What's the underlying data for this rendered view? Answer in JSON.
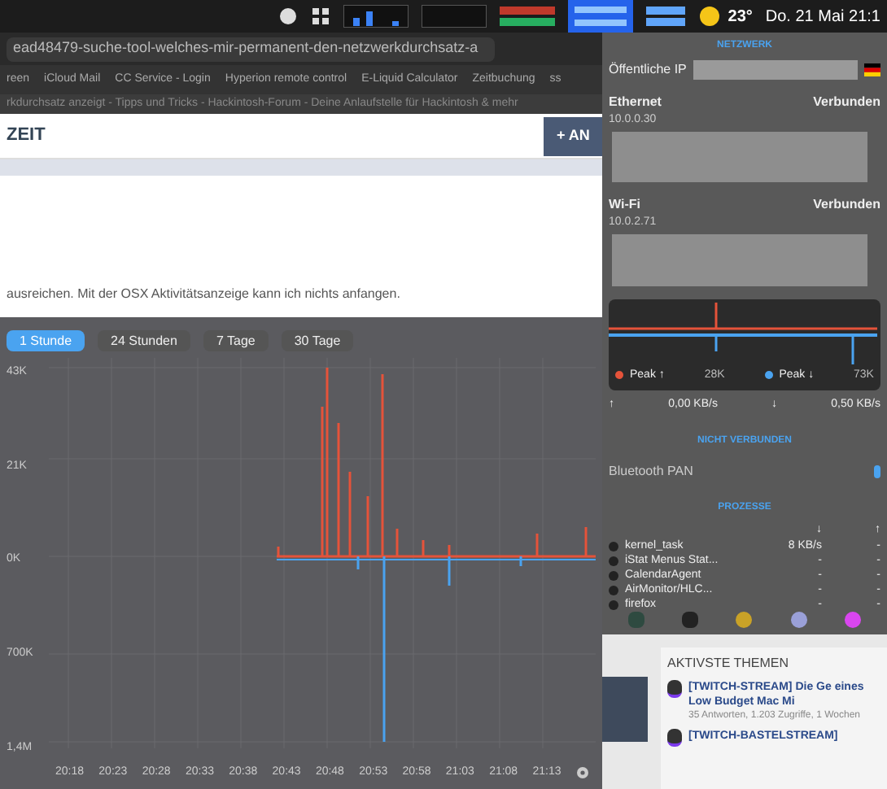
{
  "menu_bar": {
    "temperature": "23°",
    "clock": "Do. 21 Mai 21:1"
  },
  "browser": {
    "url": "ead48479-suche-tool-welches-mir-permanent-den-netzwerkdurchsatz-a",
    "bookmarks": [
      "reen",
      "iCloud Mail",
      "CC Service - Login",
      "Hyperion remote control",
      "E-Liquid Calculator",
      "Zeitbuchung",
      "ss"
    ],
    "tab_title": "rkdurchsatz anzeigt - Tipps und Tricks - Hackintosh-Forum - Deine Anlaufstelle für Hackintosh & mehr",
    "heading": "ZEIT",
    "button": "+ AN",
    "post_text": "ausreichen. Mit der OSX Aktivitätsanzeige kann ich nichts anfangen."
  },
  "chart_panel": {
    "tabs": [
      {
        "label": "1 Stunde",
        "selected": true
      },
      {
        "label": "24 Stunden",
        "selected": false
      },
      {
        "label": "7 Tage",
        "selected": false
      },
      {
        "label": "30 Tage",
        "selected": false
      }
    ],
    "y_labels": [
      "43K",
      "21K",
      "0K",
      "700K",
      "1,4M"
    ],
    "x_labels": [
      "20:18",
      "20:23",
      "20:28",
      "20:33",
      "20:38",
      "20:43",
      "20:48",
      "20:53",
      "20:58",
      "21:03",
      "21:08",
      "21:13"
    ]
  },
  "network_menu": {
    "title": "NETZWERK",
    "public_ip_label": "Öffentliche IP",
    "interfaces": [
      {
        "name": "Ethernet",
        "status": "Verbunden",
        "ip": "10.0.0.30"
      },
      {
        "name": "Wi-Fi",
        "status": "Verbunden",
        "ip": "10.0.2.71"
      }
    ],
    "peaks": [
      {
        "label": "Peak ↑",
        "value": "28K",
        "color": "#e5533a"
      },
      {
        "label": "Peak ↓",
        "value": "73K",
        "color": "#4aa3f0"
      }
    ],
    "rates": [
      {
        "arrow": "↑",
        "value": "0,00 KB/s"
      },
      {
        "arrow": "↓",
        "value": "0,50 KB/s"
      }
    ],
    "not_connected_title": "NICHT VERBUNDEN",
    "not_connected": [
      "Bluetooth PAN"
    ],
    "processes_title": "PROZESSE",
    "process_columns": [
      "↓",
      "↑"
    ],
    "processes": [
      {
        "name": "kernel_task",
        "down": "8 KB/s",
        "up": "-"
      },
      {
        "name": "iStat Menus Stat...",
        "down": "-",
        "up": "-"
      },
      {
        "name": "CalendarAgent",
        "down": "-",
        "up": "-"
      },
      {
        "name": "AirMonitor/HLC...",
        "down": "-",
        "up": "-"
      },
      {
        "name": "firefox",
        "down": "-",
        "up": "-"
      }
    ]
  },
  "forum": {
    "section_title": "AKTIVSTE THEMEN",
    "topics": [
      {
        "title": "[TWITCH-STREAM] Die Ge eines Low Budget Mac Mi",
        "meta": "35 Antworten, 1.203 Zugriffe, 1 Wochen"
      },
      {
        "title": "[TWITCH-BASTELSTREAM]"
      }
    ]
  }
}
